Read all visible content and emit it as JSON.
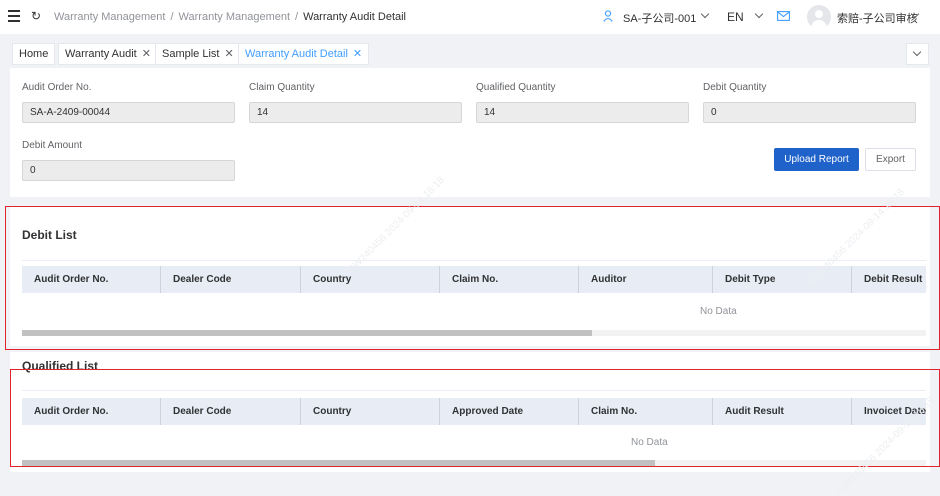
{
  "header": {
    "breadcrumb": [
      "Warranty Management",
      "Warranty Management",
      "Warranty Audit Detail"
    ],
    "company": "SA-子公司-001",
    "language": "EN",
    "username": "索赔-子公司审核",
    "icons": [
      "menu-icon",
      "refresh-icon",
      "user-icon",
      "mail-icon",
      "avatar-icon",
      "chevron-down-icon"
    ]
  },
  "tabs": [
    {
      "label": "Home",
      "closable": false,
      "active": false
    },
    {
      "label": "Warranty Audit",
      "closable": true,
      "active": false
    },
    {
      "label": "Sample List",
      "closable": true,
      "active": false
    },
    {
      "label": "Warranty Audit Detail",
      "closable": true,
      "active": true
    }
  ],
  "form": {
    "fields": [
      {
        "label": "Audit Order No.",
        "value": "SA-A-2409-00044"
      },
      {
        "label": "Claim Quantity",
        "value": "14"
      },
      {
        "label": "Qualified Quantity",
        "value": "14"
      },
      {
        "label": "Debit Quantity",
        "value": "0"
      },
      {
        "label": "Debit Amount",
        "value": "0"
      }
    ],
    "upload_label": "Upload Report",
    "export_label": "Export"
  },
  "debit_list": {
    "title": "Debit List",
    "columns": [
      "Audit Order No.",
      "Dealer Code",
      "Country",
      "Claim No.",
      "Auditor",
      "Debit Type",
      "Debit Result"
    ],
    "empty_text": "No Data",
    "scroll_fraction": 0.63
  },
  "qualified_list": {
    "title": "Qualified List",
    "columns": [
      "Audit Order No.",
      "Dealer Code",
      "Country",
      "Approved Date",
      "Claim No.",
      "Audit Result",
      "Invoicet Date"
    ],
    "empty_text": "No Data",
    "scroll_fraction": 0.7
  },
  "watermark": "GW240456 2024-09-14 18:18",
  "colors": {
    "primary": "#1f62c9",
    "link": "#409eff",
    "highlight": "#e0242d"
  }
}
